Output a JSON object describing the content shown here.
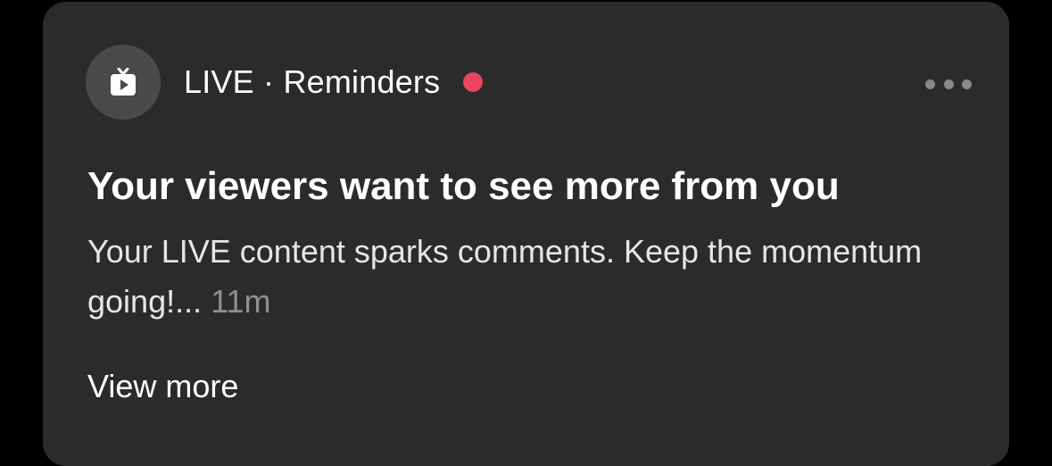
{
  "notification": {
    "source_label": "LIVE · Reminders",
    "icon": "live-tv-icon",
    "unread": true,
    "title": "Your viewers want to see more from you",
    "body": "Your LIVE content sparks comments. Keep the momentum going!...",
    "time": "11m",
    "view_more_label": "View more"
  },
  "colors": {
    "card_background": "#2b2b2b",
    "unread_dot": "#e8455f",
    "icon_background": "#4a4a4a"
  }
}
